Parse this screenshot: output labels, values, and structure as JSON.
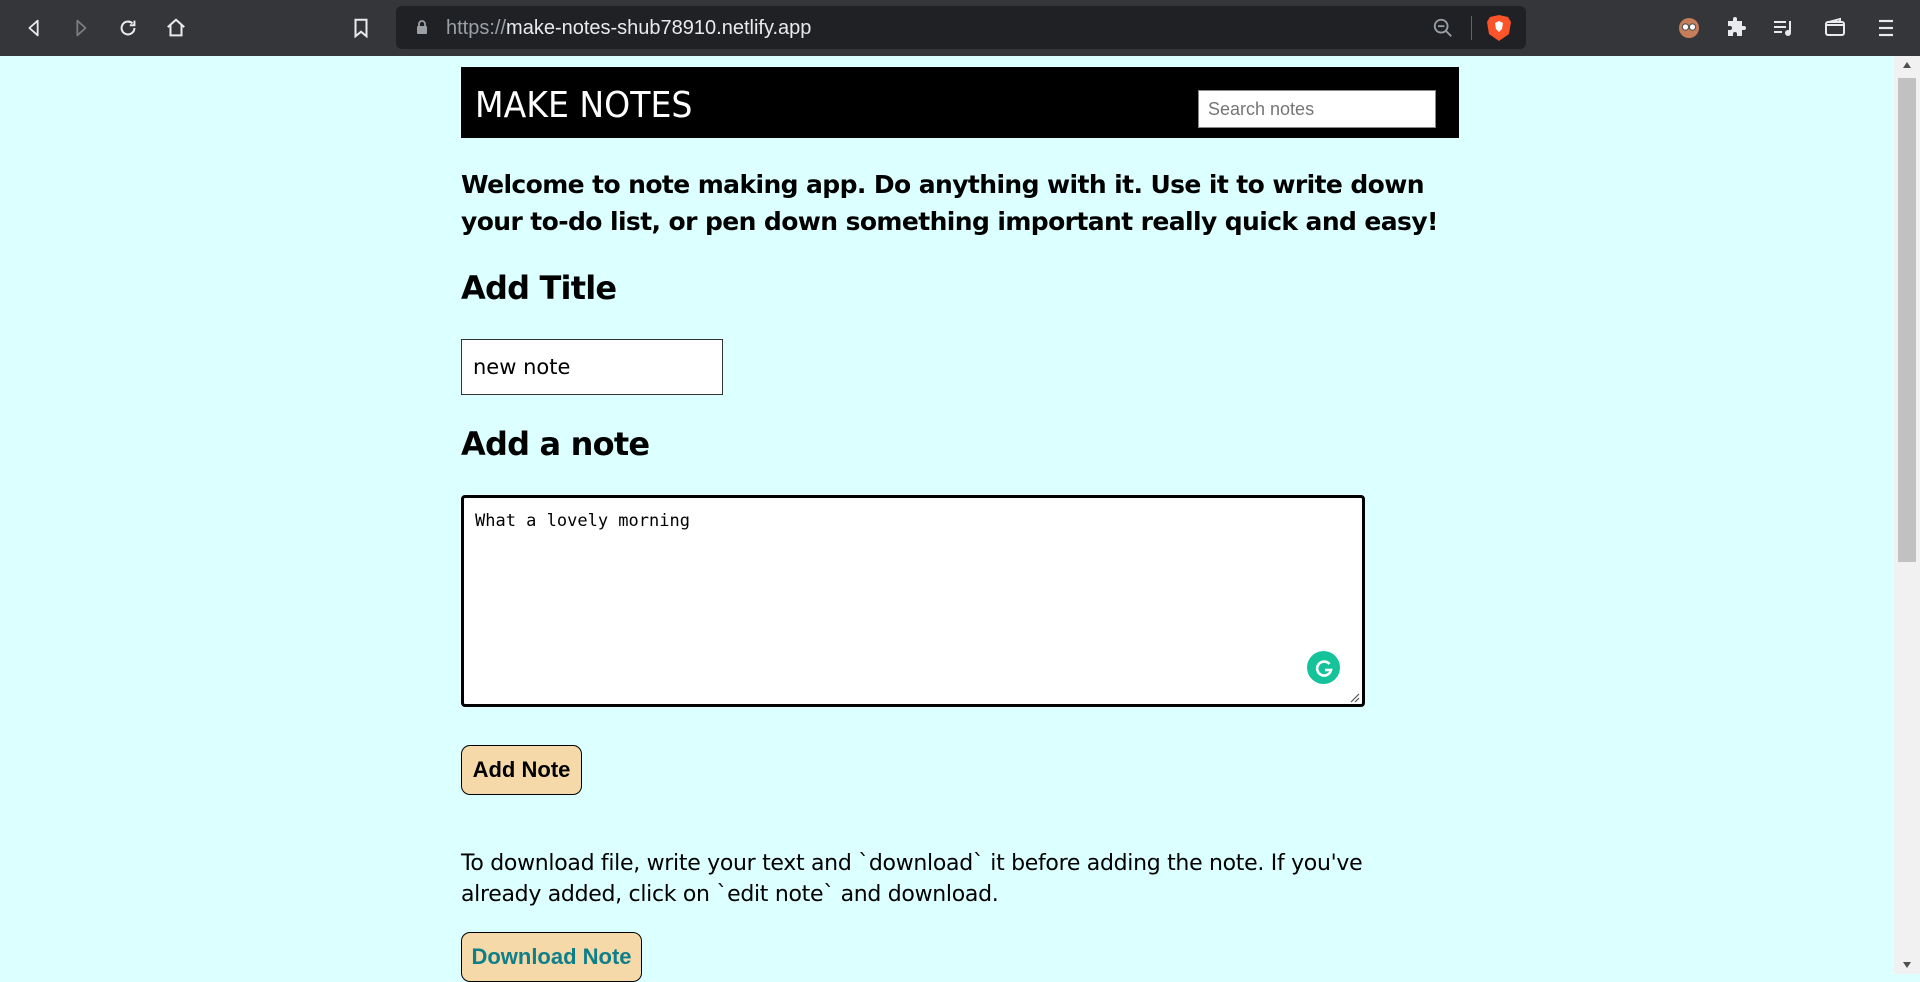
{
  "browser": {
    "url_scheme": "https://",
    "url_host": "make-notes-shub78910.netlify.app"
  },
  "header": {
    "brand": "MAKE NOTES",
    "search_placeholder": "Search notes"
  },
  "main": {
    "welcome_text": "Welcome to note making app. Do anything with it. Use it to write down your to-do list, or pen down something important really quick and easy!",
    "title_heading": "Add Title",
    "title_value": "new note",
    "note_heading": "Add a note",
    "note_value": "What a lovely morning",
    "add_button": "Add Note",
    "download_info": "To download file, write your text and `download` it before adding the note. If you've already added, click on `edit note` and download.",
    "download_button": "Download Note"
  },
  "colors": {
    "page_background": "#dcffff",
    "header_background": "#000000",
    "button_background": "#f5d9a8",
    "download_button_text": "#0e7f8a",
    "grammarly": "#15c39a"
  }
}
